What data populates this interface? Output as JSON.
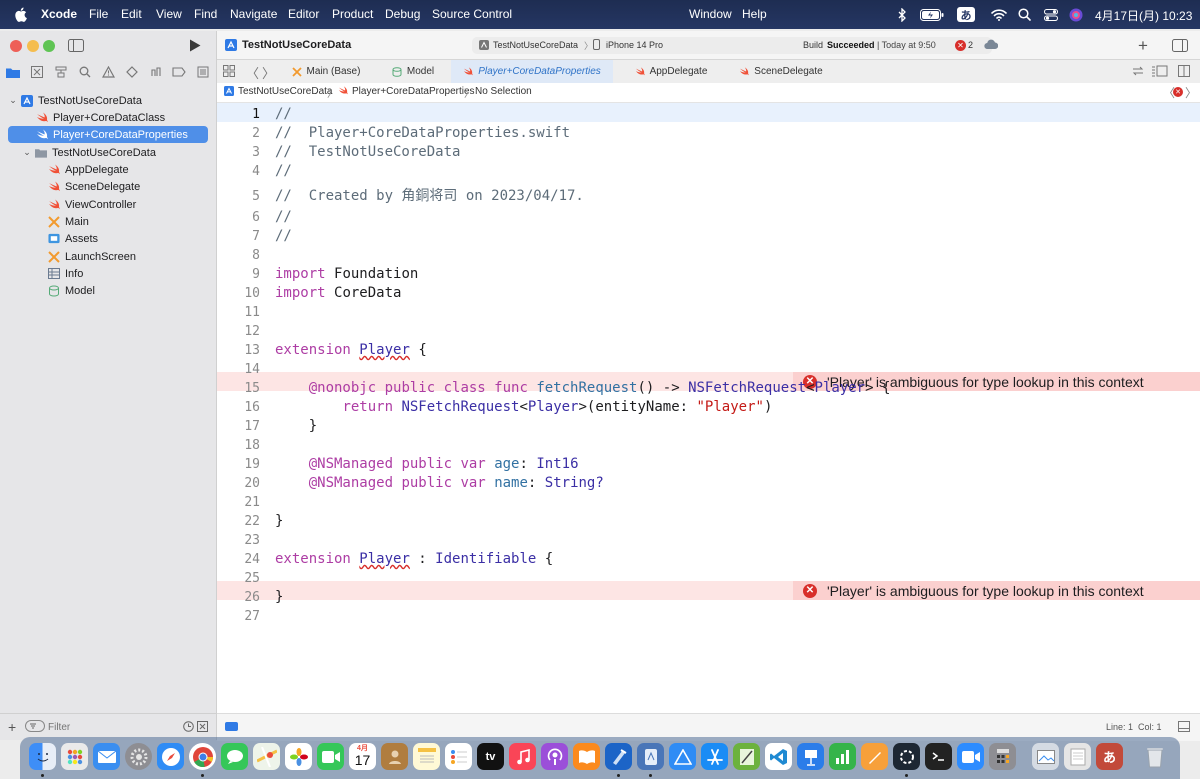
{
  "menubar": {
    "app_name": "Xcode",
    "items": [
      "File",
      "Edit",
      "View",
      "Find",
      "Navigate",
      "Editor",
      "Product",
      "Debug",
      "Source Control",
      "Window",
      "Help"
    ],
    "input_method": "あ",
    "clock": "4月17日(月) 10:23"
  },
  "toolbar": {
    "project_name": "TestNotUseCoreData",
    "scheme": "TestNotUseCoreData",
    "destination": "iPhone 14 Pro",
    "build_status_prefix": "Build",
    "build_status": "Succeeded",
    "build_time": "| Today at 9:50",
    "error_count": "2"
  },
  "navigator": {
    "items": [
      {
        "label": "TestNotUseCoreData",
        "icon": "project-icon"
      },
      {
        "label": "Player+CoreDataClass",
        "icon": "swift-file-icon"
      },
      {
        "label": "Player+CoreDataProperties",
        "icon": "swift-file-icon"
      },
      {
        "label": "TestNotUseCoreData",
        "icon": "folder-icon"
      },
      {
        "label": "AppDelegate",
        "icon": "swift-file-icon"
      },
      {
        "label": "SceneDelegate",
        "icon": "swift-file-icon"
      },
      {
        "label": "ViewController",
        "icon": "swift-file-icon"
      },
      {
        "label": "Main",
        "icon": "storyboard-icon"
      },
      {
        "label": "Assets",
        "icon": "asset-catalog-icon"
      },
      {
        "label": "LaunchScreen",
        "icon": "storyboard-icon"
      },
      {
        "label": "Info",
        "icon": "plist-icon"
      },
      {
        "label": "Model",
        "icon": "data-model-icon"
      }
    ],
    "filter_placeholder": "Filter"
  },
  "tabs": [
    {
      "label": "Main (Base)",
      "icon": "storyboard-icon"
    },
    {
      "label": "Model",
      "icon": "data-model-icon"
    },
    {
      "label": "Player+CoreDataProperties",
      "icon": "swift-file-icon"
    },
    {
      "label": "AppDelegate",
      "icon": "swift-file-icon"
    },
    {
      "label": "SceneDelegate",
      "icon": "swift-file-icon"
    }
  ],
  "jumpbar": {
    "project": "TestNotUseCoreData",
    "file": "Player+CoreDataProperties",
    "symbol": "No Selection"
  },
  "code": {
    "line_numbers": [
      "1",
      "2",
      "3",
      "4",
      "5",
      "6",
      "7",
      "8",
      "9",
      "10",
      "11",
      "12",
      "13",
      "14",
      "15",
      "16",
      "17",
      "18",
      "19",
      "20",
      "21",
      "22",
      "23",
      "24",
      "25",
      "26",
      "27"
    ],
    "l1": "//",
    "l2": "//  Player+CoreDataProperties.swift",
    "l3": "//  TestNotUseCoreData",
    "l4": "//",
    "l5": "//  Created by 角銅将司 on 2023/04/17.",
    "l6": "//",
    "l7": "//",
    "kw_import": "import",
    "l9_mod": "Foundation",
    "l10_mod": "CoreData",
    "kw_extension": "extension",
    "type_player": "Player",
    "brace_open": "{",
    "brace_close": "}",
    "attr_nonobjc": "@nonobjc",
    "kw_public_class_func": "public class func",
    "fn_fetchRequest": "fetchRequest",
    "l15_mid": "() ->",
    "type_nsfetchrequest": "NSFetchRequest",
    "lt": "<",
    "gt_brace": "> {",
    "kw_return": "return",
    "l16_tail_a": ">(entityName:",
    "l16_string": "\"Player\"",
    "l16_tail_b": ")",
    "attr_nsmanaged": "@NSManaged",
    "kw_public_var": "public var",
    "prop_age": "age",
    "colon": ":",
    "type_int16": "Int16",
    "prop_name": "name",
    "type_string": "String?",
    "l24_colon": " :",
    "type_identifiable": "Identifiable"
  },
  "errors": {
    "line13": "'Player' is ambiguous for type lookup in this context",
    "line24": "'Player' is ambiguous for type lookup in this context"
  },
  "status": {
    "position": "Line: 1  Col: 1"
  },
  "dock": {
    "calendar_month": "4月",
    "calendar_day": "17",
    "tv_label": "tv",
    "input_method": "あ"
  },
  "colors": {
    "keyword": "#ad3da4",
    "type": "#3b2fa5",
    "error": "#d82f2b",
    "selection": "#4f8fe8"
  }
}
